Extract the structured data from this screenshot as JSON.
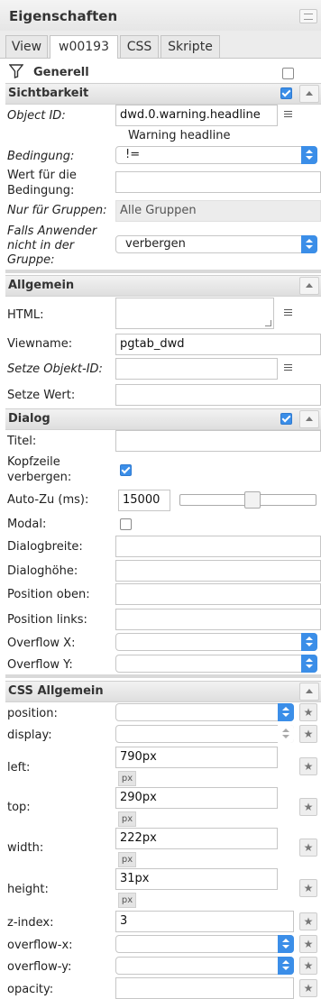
{
  "panel": {
    "title": "Eigenschaften"
  },
  "tabs": [
    {
      "label": "View"
    },
    {
      "label": "w00193"
    },
    {
      "label": "CSS"
    },
    {
      "label": "Skripte"
    }
  ],
  "filter": {
    "label": "Generell"
  },
  "sichtbarkeit": {
    "title": "Sichtbarkeit",
    "object_id_label": "Object ID:",
    "object_id_value": "dwd.0.warning.headline",
    "object_id_hint": "Warning headline",
    "bedingung_label": "Bedingung:",
    "bedingung_value": "!=",
    "wert_label_1": "Wert für die",
    "wert_label_2": "Bedingung:",
    "nur_label": "Nur für Gruppen:",
    "nur_value": "Alle Gruppen",
    "falls_label_1": "Falls Anwender",
    "falls_label_2": "nicht in der",
    "falls_label_3": "Gruppe:",
    "falls_value": "verbergen"
  },
  "allgemein": {
    "title": "Allgemein",
    "html_label": "HTML:",
    "viewname_label": "Viewname:",
    "viewname_value": "pgtab_dwd",
    "setze_objekt_label": "Setze Objekt-ID:",
    "setze_wert_label": "Setze Wert:"
  },
  "dialog": {
    "title": "Dialog",
    "titel_label": "Titel:",
    "kopfzeile_label_1": "Kopfzeile",
    "kopfzeile_label_2": "verbergen:",
    "autozu_label": "Auto-Zu (ms):",
    "autozu_value": "15000",
    "autozu_slider_fraction": 0.53,
    "modal_label": "Modal:",
    "breite_label": "Dialogbreite:",
    "hoehe_label": "Dialoghöhe:",
    "oben_label": "Position oben:",
    "links_label": "Position links:",
    "overflow_x_label": "Overflow X:",
    "overflow_y_label": "Overflow Y:"
  },
  "css": {
    "title": "CSS Allgemein",
    "position_label": "position:",
    "display_label": "display:",
    "left_label": "left:",
    "left_value": "790px",
    "top_label": "top:",
    "top_value": "290px",
    "width_label": "width:",
    "width_value": "222px",
    "height_label": "height:",
    "height_value": "31px",
    "unit_label": "px",
    "zindex_label": "z-index:",
    "zindex_value": "3",
    "overflowx_label": "overflow-x:",
    "overflowy_label": "overflow-y:",
    "opacity_label": "opacity:"
  },
  "icons": {
    "star": "★"
  },
  "colors": {
    "accent": "#3b8ee8"
  }
}
